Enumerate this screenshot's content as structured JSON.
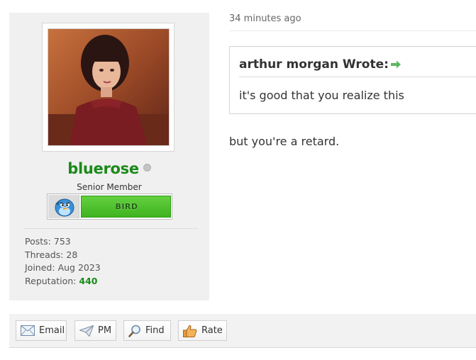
{
  "author": {
    "username": "bluerose",
    "user_title": "Senior Member",
    "rank_label": "BIRD",
    "online_status_icon": "offline-dot-icon",
    "rank_icon": "blue-bird-icon",
    "stats": [
      {
        "label": "Posts:",
        "value": "753"
      },
      {
        "label": "Threads:",
        "value": "28"
      },
      {
        "label": "Joined:",
        "value": "Aug 2023"
      },
      {
        "label": "Reputation:",
        "value": "440"
      }
    ],
    "colors": {
      "username": "#1a8a1a",
      "reputation": "#1a8a1a",
      "rank_bar": "#4cc22a"
    }
  },
  "post": {
    "date": "34 minutes ago",
    "quote": {
      "author_line": "arthur morgan Wrote:",
      "arrow_icon": "green-arrow-right-icon",
      "text": "it's good that you realize this"
    },
    "message": "but you're a retard."
  },
  "controls": {
    "email": {
      "label": "Email",
      "icon": "envelope-icon"
    },
    "pm": {
      "label": "PM",
      "icon": "paper-plane-icon"
    },
    "find": {
      "label": "Find",
      "icon": "magnifier-icon"
    },
    "rate": {
      "label": "Rate",
      "icon": "thumbs-up-icon"
    }
  }
}
